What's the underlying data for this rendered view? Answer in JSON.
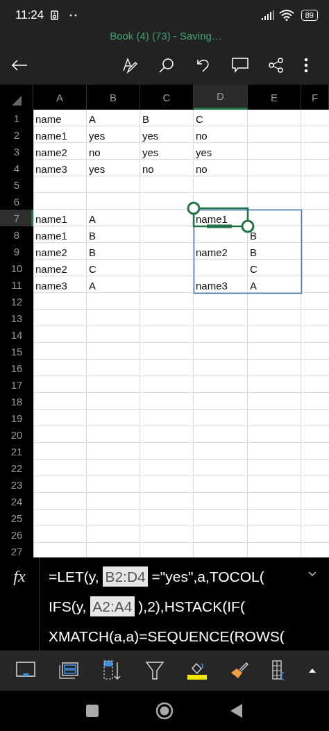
{
  "status_bar": {
    "time": "11:24",
    "battery": "89"
  },
  "document": {
    "title": "Book (4) (73) - Saving…"
  },
  "columns": [
    {
      "label": "A",
      "selected": false
    },
    {
      "label": "B",
      "selected": false
    },
    {
      "label": "C",
      "selected": false
    },
    {
      "label": "D",
      "selected": true
    },
    {
      "label": "E",
      "selected": false
    },
    {
      "label": "F",
      "selected": false
    }
  ],
  "rows": [
    {
      "header": "1",
      "selected": false,
      "cells": [
        "name",
        "A",
        "B",
        "C",
        null,
        null
      ]
    },
    {
      "header": "2",
      "selected": false,
      "cells": [
        "name1",
        "yes",
        "yes",
        "no",
        null,
        null
      ]
    },
    {
      "header": "3",
      "selected": false,
      "cells": [
        "name2",
        "no",
        "yes",
        "yes",
        null,
        null
      ]
    },
    {
      "header": "4",
      "selected": false,
      "cells": [
        "name3",
        "yes",
        "no",
        "no",
        null,
        null
      ]
    },
    {
      "header": "5",
      "selected": false,
      "cells": [
        null,
        null,
        null,
        null,
        null,
        null
      ]
    },
    {
      "header": "6",
      "selected": false,
      "cells": [
        null,
        null,
        null,
        null,
        null,
        null
      ]
    },
    {
      "header": "7",
      "selected": true,
      "cells": [
        "name1",
        "A",
        null,
        "name1",
        null,
        null
      ]
    },
    {
      "header": "8",
      "selected": false,
      "cells": [
        "name1",
        "B",
        null,
        null,
        "B",
        null
      ]
    },
    {
      "header": "9",
      "selected": false,
      "cells": [
        "name2",
        "B",
        null,
        "name2",
        "B",
        null
      ]
    },
    {
      "header": "10",
      "selected": false,
      "cells": [
        "name2",
        "C",
        null,
        null,
        "C",
        null
      ]
    },
    {
      "header": "11",
      "selected": false,
      "cells": [
        "name3",
        "A",
        null,
        "name3",
        "A",
        null
      ]
    },
    {
      "header": "12",
      "selected": false,
      "cells": []
    },
    {
      "header": "13",
      "selected": false,
      "cells": []
    },
    {
      "header": "14",
      "selected": false,
      "cells": []
    },
    {
      "header": "15",
      "selected": false,
      "cells": []
    },
    {
      "header": "16",
      "selected": false,
      "cells": []
    },
    {
      "header": "17",
      "selected": false,
      "cells": []
    },
    {
      "header": "18",
      "selected": false,
      "cells": []
    },
    {
      "header": "19",
      "selected": false,
      "cells": []
    },
    {
      "header": "20",
      "selected": false,
      "cells": []
    },
    {
      "header": "21",
      "selected": false,
      "cells": []
    },
    {
      "header": "22",
      "selected": false,
      "cells": []
    },
    {
      "header": "23",
      "selected": false,
      "cells": []
    },
    {
      "header": "24",
      "selected": false,
      "cells": []
    },
    {
      "header": "25",
      "selected": false,
      "cells": []
    },
    {
      "header": "26",
      "selected": false,
      "cells": []
    },
    {
      "header": "27",
      "selected": false,
      "cells": []
    }
  ],
  "formula_bar": {
    "label": "fx",
    "lines": [
      [
        {
          "text": "=LET(y, ",
          "ref": false
        },
        {
          "text": "B2:D4",
          "ref": true
        },
        {
          "text": " =\"yes\",a,TOCOL(",
          "ref": false
        }
      ],
      [
        {
          "text": "IFS(y, ",
          "ref": false
        },
        {
          "text": "A2:A4",
          "ref": true
        },
        {
          "text": " ),2),HSTACK(IF(",
          "ref": false
        }
      ],
      [
        {
          "text": "XMATCH(a,a)=SEQUENCE(ROWS(",
          "ref": false
        }
      ]
    ]
  }
}
